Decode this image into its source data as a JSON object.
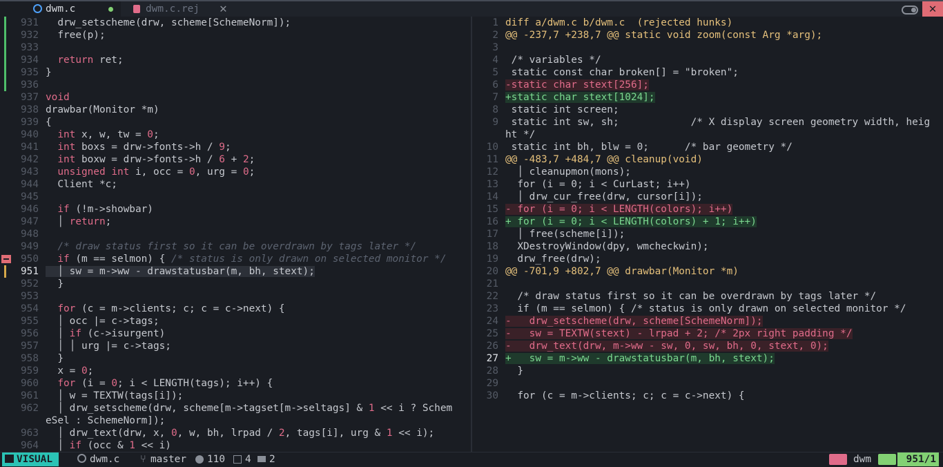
{
  "tabs": [
    {
      "label": "dwm.c",
      "icon": "c-file-icon",
      "modified": true
    },
    {
      "label": "dwm.c.rej",
      "icon": "rej-file-icon"
    }
  ],
  "tab_close_glyph": "✕",
  "colors": {
    "keyword": "#e06c8a",
    "number": "#e06c8a",
    "type": "#e06c8a",
    "comment": "#5c6370",
    "added_line": "#7bd88f",
    "removed_line": "#e06c8a",
    "diff_header": "#e5c07b",
    "mode_bg": "#2bc3b5",
    "position_bg": "#82d173"
  },
  "left_pane": {
    "lines": [
      {
        "n": "931",
        "git": "add",
        "code": "  drw_setscheme(drw, scheme[SchemeNorm]);"
      },
      {
        "n": "932",
        "git": "add",
        "code": "  free(p);"
      },
      {
        "n": "933",
        "git": "add",
        "code": ""
      },
      {
        "n": "934",
        "git": "add",
        "code": "  return ret;"
      },
      {
        "n": "935",
        "git": "add",
        "code": "}"
      },
      {
        "n": "936",
        "git": "add",
        "code": ""
      },
      {
        "n": "937",
        "code": "void"
      },
      {
        "n": "938",
        "code": "drawbar(Monitor *m)"
      },
      {
        "n": "939",
        "code": "{"
      },
      {
        "n": "940",
        "code": "  int x, w, tw = 0;"
      },
      {
        "n": "941",
        "code": "  int boxs = drw->fonts->h / 9;"
      },
      {
        "n": "942",
        "code": "  int boxw = drw->fonts->h / 6 + 2;"
      },
      {
        "n": "943",
        "code": "  unsigned int i, occ = 0, urg = 0;"
      },
      {
        "n": "944",
        "code": "  Client *c;"
      },
      {
        "n": "945",
        "code": ""
      },
      {
        "n": "946",
        "code": "  if (!m->showbar)"
      },
      {
        "n": "947",
        "code": "  │ return;"
      },
      {
        "n": "948",
        "code": ""
      },
      {
        "n": "949",
        "code": "  /* draw status first so it can be overdrawn by tags later */"
      },
      {
        "n": "950",
        "git": "del",
        "code": "  if (m == selmon) { /* status is only drawn on selected monitor */"
      },
      {
        "n": "951",
        "git": "mod",
        "current": true,
        "code": "  │ sw = m->ww - drawstatusbar(m, bh, stext);"
      },
      {
        "n": "952",
        "code": "  }"
      },
      {
        "n": "953",
        "code": ""
      },
      {
        "n": "954",
        "code": "  for (c = m->clients; c; c = c->next) {"
      },
      {
        "n": "955",
        "code": "  │ occ |= c->tags;"
      },
      {
        "n": "956",
        "code": "  │ if (c->isurgent)"
      },
      {
        "n": "957",
        "code": "  │ │ urg |= c->tags;"
      },
      {
        "n": "958",
        "code": "  }"
      },
      {
        "n": "959",
        "code": "  x = 0;"
      },
      {
        "n": "960",
        "code": "  for (i = 0; i < LENGTH(tags); i++) {"
      },
      {
        "n": "961",
        "code": "  │ w = TEXTW(tags[i]);"
      },
      {
        "n": "962",
        "code": "  │ drw_setscheme(drw, scheme[m->tagset[m->seltags] & 1 << i ? Schem"
      },
      {
        "n": "",
        "code": "eSel : SchemeNorm]);"
      },
      {
        "n": "963",
        "code": "  │ drw_text(drw, x, 0, w, bh, lrpad / 2, tags[i], urg & 1 << i);"
      },
      {
        "n": "964",
        "code": "  │ if (occ & 1 << i)"
      }
    ]
  },
  "right_pane": {
    "lines": [
      {
        "n": "1",
        "kind": "hdr",
        "code": "diff a/dwm.c b/dwm.c  (rejected hunks)"
      },
      {
        "n": "2",
        "kind": "hunk",
        "code": "@@ -237,7 +238,7 @@ static void zoom(const Arg *arg);"
      },
      {
        "n": "3",
        "code": ""
      },
      {
        "n": "4",
        "code": " /* variables */"
      },
      {
        "n": "5",
        "code": " static const char broken[] = \"broken\";"
      },
      {
        "n": "6",
        "kind": "del",
        "code": "-static char stext[256];"
      },
      {
        "n": "7",
        "kind": "add",
        "code": "+static char stext[1024];"
      },
      {
        "n": "8",
        "code": " static int screen;"
      },
      {
        "n": "9",
        "code": " static int sw, sh;            /* X display screen geometry width, heig"
      },
      {
        "n": "",
        "code": "ht */"
      },
      {
        "n": "10",
        "code": " static int bh, blw = 0;      /* bar geometry */"
      },
      {
        "n": "11",
        "kind": "hunk",
        "code": "@@ -483,7 +484,7 @@ cleanup(void)"
      },
      {
        "n": "12",
        "code": "  │ cleanupmon(mons);"
      },
      {
        "n": "13",
        "code": "  for (i = 0; i < CurLast; i++)"
      },
      {
        "n": "14",
        "code": "  │ drw_cur_free(drw, cursor[i]);"
      },
      {
        "n": "15",
        "kind": "del",
        "code": "- for (i = 0; i < LENGTH(colors); i++)"
      },
      {
        "n": "16",
        "kind": "add",
        "code": "+ for (i = 0; i < LENGTH(colors) + 1; i++)"
      },
      {
        "n": "17",
        "code": "  │ free(scheme[i]);"
      },
      {
        "n": "18",
        "code": "  XDestroyWindow(dpy, wmcheckwin);"
      },
      {
        "n": "19",
        "code": "  drw_free(drw);"
      },
      {
        "n": "20",
        "kind": "hunk",
        "code": "@@ -701,9 +802,7 @@ drawbar(Monitor *m)"
      },
      {
        "n": "21",
        "code": ""
      },
      {
        "n": "22",
        "code": "  /* draw status first so it can be overdrawn by tags later */"
      },
      {
        "n": "23",
        "code": "  if (m == selmon) { /* status is only drawn on selected monitor */"
      },
      {
        "n": "24",
        "kind": "del",
        "code": "-   drw_setscheme(drw, scheme[SchemeNorm]);"
      },
      {
        "n": "25",
        "kind": "del",
        "code": "-   sw = TEXTW(stext) - lrpad + 2; /* 2px right padding */"
      },
      {
        "n": "26",
        "kind": "del",
        "code": "-   drw_text(drw, m->ww - sw, 0, sw, bh, 0, stext, 0);"
      },
      {
        "n": "27",
        "kind": "add",
        "current": true,
        "code": "+   sw = m->ww - drawstatusbar(m, bh, stext);"
      },
      {
        "n": "28",
        "code": "  }"
      },
      {
        "n": "29",
        "code": ""
      },
      {
        "n": "30",
        "code": "  for (c = m->clients; c; c = c->next) {"
      }
    ]
  },
  "status": {
    "mode": "VISUAL",
    "file": "dwm.c",
    "branch": "master",
    "added": "110",
    "modified": "4",
    "removed": "2",
    "filetype": "dwm",
    "position": "951/1"
  }
}
